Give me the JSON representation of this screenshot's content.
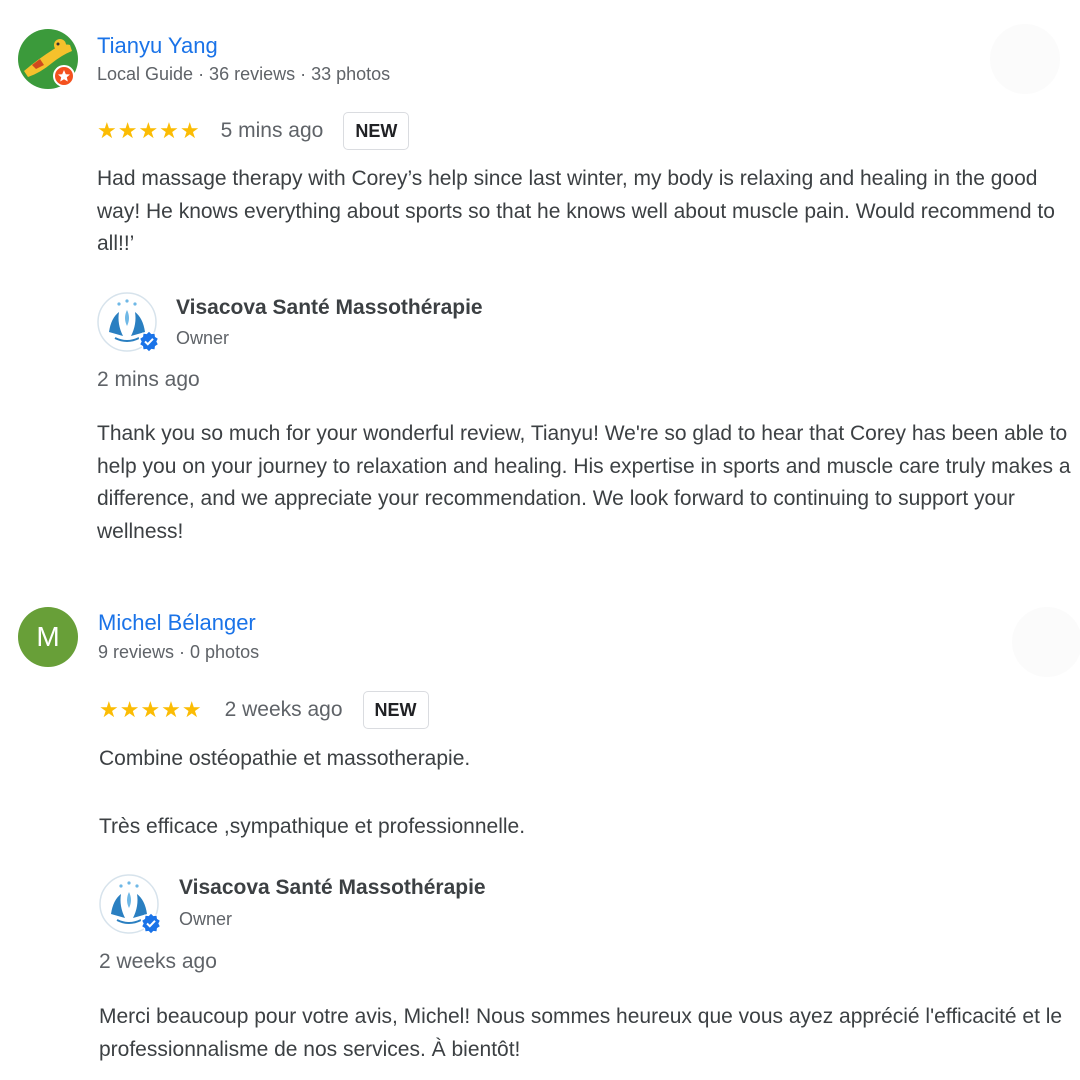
{
  "reviews": [
    {
      "reviewer_name": "Tianyu Yang",
      "reviewer_meta": "Local Guide · 36 reviews · 33 photos",
      "stars": "★★★★★",
      "time": "5 mins ago",
      "badge": "NEW",
      "text": "Had massage therapy with Corey’s help since last winter, my body is relaxing and healing in the good way! He knows everything about sports so that he knows well about muscle pain. Would recommend to all!!’",
      "owner_name": "Visacova Santé Massothérapie",
      "owner_role": "Owner",
      "reply_time": "2 mins ago",
      "reply_text": "Thank you so much for your wonderful review, Tianyu! We're so glad to hear that Corey has been able to help you on your journey to relaxation and healing. His expertise in sports and muscle care truly makes a difference, and we appreciate your recommendation. We look forward to continuing to support your wellness!"
    },
    {
      "reviewer_name": "Michel Bélanger",
      "avatar_letter": "M",
      "reviewer_meta": "9 reviews · 0 photos",
      "stars": "★★★★★",
      "time": "2 weeks ago",
      "badge": "NEW",
      "text_paragraphs": [
        "Combine ostéopathie et massotherapie.",
        "Très efficace ,sympathique et professionnelle."
      ],
      "owner_name": "Visacova Santé Massothérapie",
      "owner_role": "Owner",
      "reply_time": "2 weeks ago",
      "reply_text": "Merci beaucoup pour votre avis, Michel! Nous sommes heureux que vous ayez apprécié l'efficacité et le professionnalisme de nos services. À bientôt!"
    }
  ],
  "colors": {
    "name_link": "#1a73e8",
    "star": "#fbbc04",
    "avatar_m_bg": "#689f38",
    "local_guide_badge": "#f4511e",
    "verified": "#1a73e8"
  },
  "icons": {
    "local_guide": "local-guide-star-icon",
    "verified": "verified-check-icon",
    "owner_logo": "hands-lotus-logo"
  }
}
